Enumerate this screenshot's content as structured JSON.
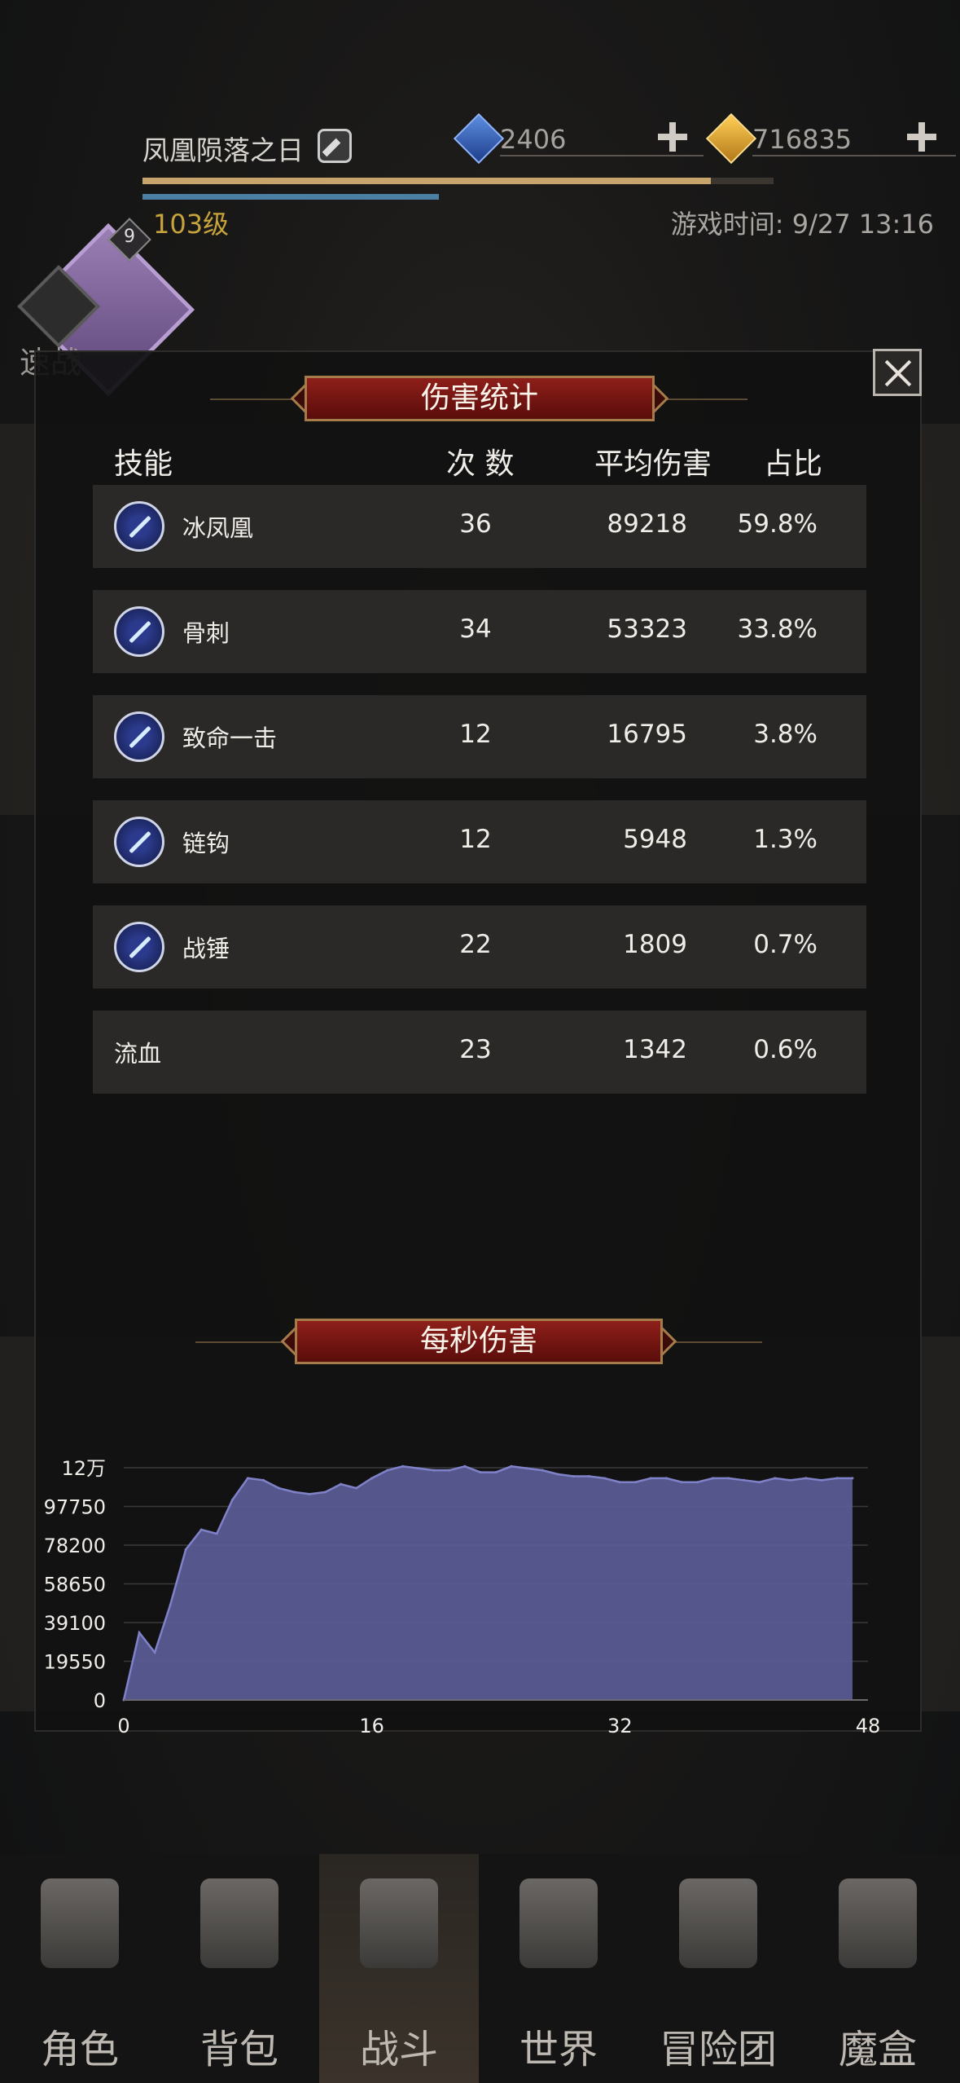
{
  "header": {
    "player_name": "凤凰陨落之日",
    "level_badge": "9",
    "player_level": "103级",
    "game_time": "游戏时间: 9/27 13:16",
    "xp_fraction": 0.9,
    "mp_fraction": 0.47,
    "gems": "2406",
    "gold": "716835"
  },
  "quick_battle": {
    "label": "速战"
  },
  "modal": {
    "title": "伤害统计",
    "columns": {
      "skill": "技能",
      "count": "次 数",
      "avg": "平均伤害",
      "share": "占比"
    },
    "rows": [
      {
        "name": "冰凤凰",
        "count": "36",
        "avg": "89218",
        "share": "59.8%",
        "icon": "ice-phoenix-icon"
      },
      {
        "name": "骨刺",
        "count": "34",
        "avg": "53323",
        "share": "33.8%",
        "icon": "bone-spike-icon"
      },
      {
        "name": "致命一击",
        "count": "12",
        "avg": "16795",
        "share": "3.8%",
        "icon": "critical-strike-icon"
      },
      {
        "name": "链钩",
        "count": "12",
        "avg": "5948",
        "share": "1.3%",
        "icon": "chain-hook-icon"
      },
      {
        "name": "战锤",
        "count": "22",
        "avg": "1809",
        "share": "0.7%",
        "icon": "war-hammer-icon"
      },
      {
        "name": "流血",
        "count": "23",
        "avg": "1342",
        "share": "0.6%",
        "icon": ""
      }
    ],
    "dps_title": "每秒伤害"
  },
  "chart_data": {
    "type": "area",
    "title": "每秒伤害",
    "xlabel": "",
    "ylabel": "",
    "xlim": [
      0,
      48
    ],
    "ylim": [
      0,
      117300
    ],
    "x_ticks": [
      "0",
      "16",
      "32",
      "48"
    ],
    "y_ticks": [
      "0",
      "19550",
      "39100",
      "58650",
      "78200",
      "97750",
      "12万"
    ],
    "fill_color": "#5a5c94",
    "x": [
      0,
      1,
      2,
      3,
      4,
      5,
      6,
      7,
      8,
      9,
      10,
      11,
      12,
      13,
      14,
      15,
      16,
      17,
      18,
      19,
      20,
      21,
      22,
      23,
      24,
      25,
      26,
      27,
      28,
      29,
      30,
      31,
      32,
      33,
      34,
      35,
      36,
      37,
      38,
      39,
      40,
      41,
      42,
      43,
      44,
      45,
      46,
      47
    ],
    "values": [
      0,
      34000,
      24000,
      48000,
      76000,
      86000,
      84000,
      101000,
      112000,
      111000,
      107000,
      105000,
      104000,
      105000,
      109000,
      107000,
      112000,
      116000,
      118000,
      117000,
      116000,
      116000,
      118000,
      115000,
      115000,
      118000,
      117000,
      116000,
      114000,
      113000,
      113000,
      112000,
      110000,
      110000,
      112000,
      112000,
      110000,
      110000,
      112000,
      112000,
      111000,
      110000,
      112000,
      111000,
      112000,
      111000,
      112000,
      112000
    ]
  },
  "nav": {
    "items": [
      {
        "label": "角色",
        "icon": "helmet-icon"
      },
      {
        "label": "背包",
        "icon": "backpack-icon"
      },
      {
        "label": "战斗",
        "icon": "sword-shield-icon"
      },
      {
        "label": "世界",
        "icon": "map-scroll-icon"
      },
      {
        "label": "冒险团",
        "icon": "castle-icon"
      },
      {
        "label": "魔盒",
        "icon": "magic-box-icon"
      }
    ],
    "active_index": 2
  },
  "colors": {
    "banner_red": "#8e1f1a",
    "banner_border": "#a57b4a",
    "row_bg": "#2a2927",
    "level_gold": "#c7a43b",
    "chart_fill": "#5a5c94",
    "chart_line": "#7f82c8"
  }
}
